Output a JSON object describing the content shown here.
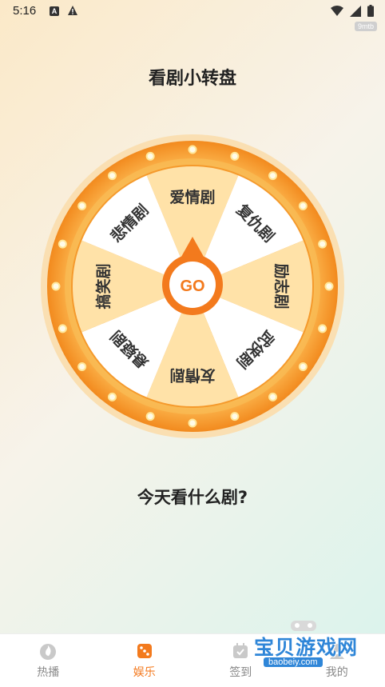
{
  "status_bar": {
    "time": "5:16",
    "app_badge": "A",
    "tag": "9mtb"
  },
  "page": {
    "title": "看剧小转盘",
    "question": "今天看什么剧?"
  },
  "wheel": {
    "go_label": "GO",
    "segments": [
      "爱情剧",
      "复仇剧",
      "励志剧",
      "武侠剧",
      "友情剧",
      "悬疑剧",
      "搞笑剧",
      "悲情剧"
    ],
    "colors": {
      "ring_outer": "#f7a23c",
      "ring_inner": "#fbc96a",
      "segment_a": "#ffe2a8",
      "segment_b": "#ffffff",
      "center": "#f37a1d"
    }
  },
  "tabbar": {
    "items": [
      {
        "label": "热播",
        "icon": "flame-icon",
        "active": false
      },
      {
        "label": "娱乐",
        "icon": "dice-icon",
        "active": true
      },
      {
        "label": "签到",
        "icon": "calendar-icon",
        "active": false
      },
      {
        "label": "我的",
        "icon": "user-icon",
        "active": false
      }
    ]
  },
  "watermark": {
    "title": "宝贝游戏网",
    "url": "baobeiy.com"
  }
}
